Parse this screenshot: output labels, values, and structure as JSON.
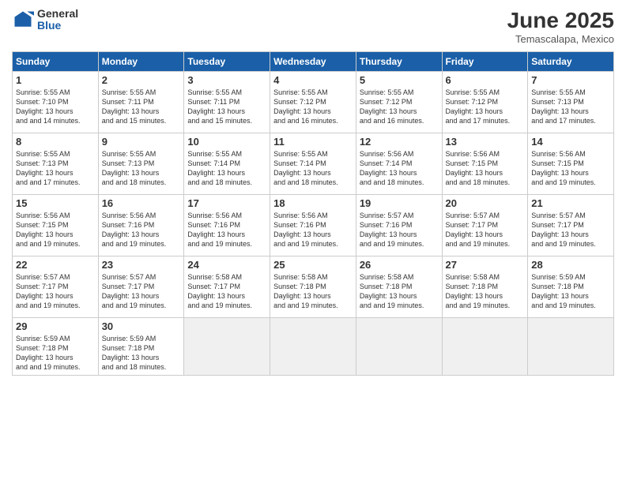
{
  "logo": {
    "general": "General",
    "blue": "Blue"
  },
  "header": {
    "month_year": "June 2025",
    "location": "Temascalapa, Mexico"
  },
  "weekdays": [
    "Sunday",
    "Monday",
    "Tuesday",
    "Wednesday",
    "Thursday",
    "Friday",
    "Saturday"
  ],
  "weeks": [
    [
      {
        "day": "1",
        "sunrise": "Sunrise: 5:55 AM",
        "sunset": "Sunset: 7:10 PM",
        "daylight": "Daylight: 13 hours and 14 minutes."
      },
      {
        "day": "2",
        "sunrise": "Sunrise: 5:55 AM",
        "sunset": "Sunset: 7:11 PM",
        "daylight": "Daylight: 13 hours and 15 minutes."
      },
      {
        "day": "3",
        "sunrise": "Sunrise: 5:55 AM",
        "sunset": "Sunset: 7:11 PM",
        "daylight": "Daylight: 13 hours and 15 minutes."
      },
      {
        "day": "4",
        "sunrise": "Sunrise: 5:55 AM",
        "sunset": "Sunset: 7:12 PM",
        "daylight": "Daylight: 13 hours and 16 minutes."
      },
      {
        "day": "5",
        "sunrise": "Sunrise: 5:55 AM",
        "sunset": "Sunset: 7:12 PM",
        "daylight": "Daylight: 13 hours and 16 minutes."
      },
      {
        "day": "6",
        "sunrise": "Sunrise: 5:55 AM",
        "sunset": "Sunset: 7:12 PM",
        "daylight": "Daylight: 13 hours and 17 minutes."
      },
      {
        "day": "7",
        "sunrise": "Sunrise: 5:55 AM",
        "sunset": "Sunset: 7:13 PM",
        "daylight": "Daylight: 13 hours and 17 minutes."
      }
    ],
    [
      {
        "day": "8",
        "sunrise": "Sunrise: 5:55 AM",
        "sunset": "Sunset: 7:13 PM",
        "daylight": "Daylight: 13 hours and 17 minutes."
      },
      {
        "day": "9",
        "sunrise": "Sunrise: 5:55 AM",
        "sunset": "Sunset: 7:13 PM",
        "daylight": "Daylight: 13 hours and 18 minutes."
      },
      {
        "day": "10",
        "sunrise": "Sunrise: 5:55 AM",
        "sunset": "Sunset: 7:14 PM",
        "daylight": "Daylight: 13 hours and 18 minutes."
      },
      {
        "day": "11",
        "sunrise": "Sunrise: 5:55 AM",
        "sunset": "Sunset: 7:14 PM",
        "daylight": "Daylight: 13 hours and 18 minutes."
      },
      {
        "day": "12",
        "sunrise": "Sunrise: 5:56 AM",
        "sunset": "Sunset: 7:14 PM",
        "daylight": "Daylight: 13 hours and 18 minutes."
      },
      {
        "day": "13",
        "sunrise": "Sunrise: 5:56 AM",
        "sunset": "Sunset: 7:15 PM",
        "daylight": "Daylight: 13 hours and 18 minutes."
      },
      {
        "day": "14",
        "sunrise": "Sunrise: 5:56 AM",
        "sunset": "Sunset: 7:15 PM",
        "daylight": "Daylight: 13 hours and 19 minutes."
      }
    ],
    [
      {
        "day": "15",
        "sunrise": "Sunrise: 5:56 AM",
        "sunset": "Sunset: 7:15 PM",
        "daylight": "Daylight: 13 hours and 19 minutes."
      },
      {
        "day": "16",
        "sunrise": "Sunrise: 5:56 AM",
        "sunset": "Sunset: 7:16 PM",
        "daylight": "Daylight: 13 hours and 19 minutes."
      },
      {
        "day": "17",
        "sunrise": "Sunrise: 5:56 AM",
        "sunset": "Sunset: 7:16 PM",
        "daylight": "Daylight: 13 hours and 19 minutes."
      },
      {
        "day": "18",
        "sunrise": "Sunrise: 5:56 AM",
        "sunset": "Sunset: 7:16 PM",
        "daylight": "Daylight: 13 hours and 19 minutes."
      },
      {
        "day": "19",
        "sunrise": "Sunrise: 5:57 AM",
        "sunset": "Sunset: 7:16 PM",
        "daylight": "Daylight: 13 hours and 19 minutes."
      },
      {
        "day": "20",
        "sunrise": "Sunrise: 5:57 AM",
        "sunset": "Sunset: 7:17 PM",
        "daylight": "Daylight: 13 hours and 19 minutes."
      },
      {
        "day": "21",
        "sunrise": "Sunrise: 5:57 AM",
        "sunset": "Sunset: 7:17 PM",
        "daylight": "Daylight: 13 hours and 19 minutes."
      }
    ],
    [
      {
        "day": "22",
        "sunrise": "Sunrise: 5:57 AM",
        "sunset": "Sunset: 7:17 PM",
        "daylight": "Daylight: 13 hours and 19 minutes."
      },
      {
        "day": "23",
        "sunrise": "Sunrise: 5:57 AM",
        "sunset": "Sunset: 7:17 PM",
        "daylight": "Daylight: 13 hours and 19 minutes."
      },
      {
        "day": "24",
        "sunrise": "Sunrise: 5:58 AM",
        "sunset": "Sunset: 7:17 PM",
        "daylight": "Daylight: 13 hours and 19 minutes."
      },
      {
        "day": "25",
        "sunrise": "Sunrise: 5:58 AM",
        "sunset": "Sunset: 7:18 PM",
        "daylight": "Daylight: 13 hours and 19 minutes."
      },
      {
        "day": "26",
        "sunrise": "Sunrise: 5:58 AM",
        "sunset": "Sunset: 7:18 PM",
        "daylight": "Daylight: 13 hours and 19 minutes."
      },
      {
        "day": "27",
        "sunrise": "Sunrise: 5:58 AM",
        "sunset": "Sunset: 7:18 PM",
        "daylight": "Daylight: 13 hours and 19 minutes."
      },
      {
        "day": "28",
        "sunrise": "Sunrise: 5:59 AM",
        "sunset": "Sunset: 7:18 PM",
        "daylight": "Daylight: 13 hours and 19 minutes."
      }
    ],
    [
      {
        "day": "29",
        "sunrise": "Sunrise: 5:59 AM",
        "sunset": "Sunset: 7:18 PM",
        "daylight": "Daylight: 13 hours and 19 minutes."
      },
      {
        "day": "30",
        "sunrise": "Sunrise: 5:59 AM",
        "sunset": "Sunset: 7:18 PM",
        "daylight": "Daylight: 13 hours and 18 minutes."
      },
      null,
      null,
      null,
      null,
      null
    ]
  ]
}
